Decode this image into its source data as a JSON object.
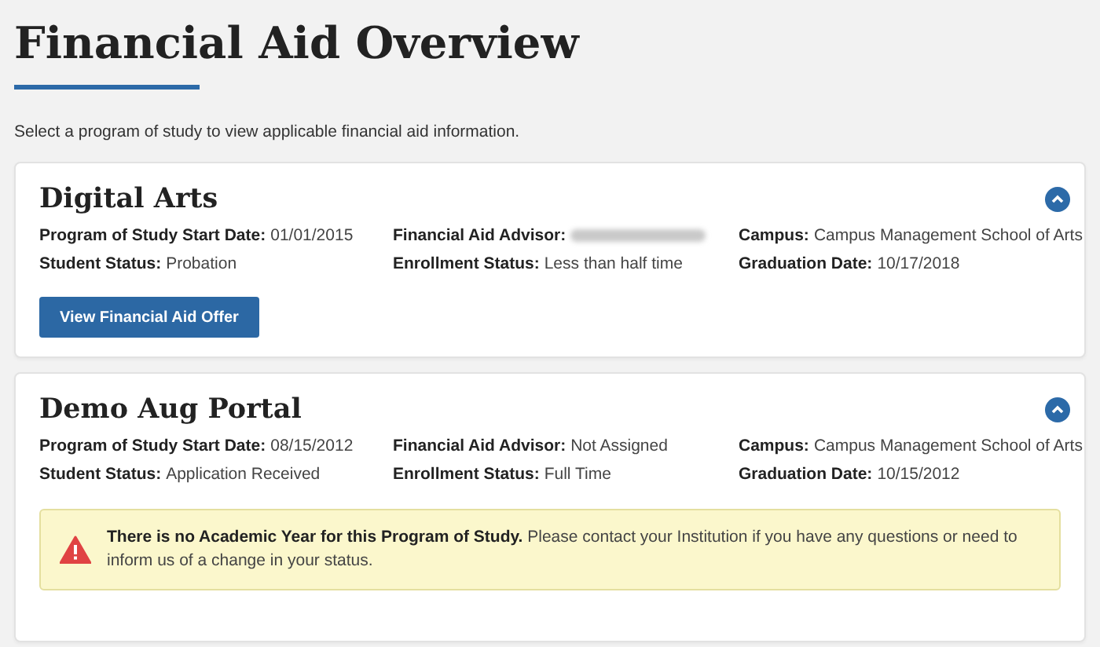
{
  "page": {
    "title": "Financial Aid Overview",
    "subtitle": "Select a program of study to view applicable financial aid information."
  },
  "programs": [
    {
      "name": "Digital Arts",
      "expanded": true,
      "fields": [
        {
          "label": "Program of Study Start Date:",
          "value": "01/01/2015"
        },
        {
          "label": "Financial Aid Advisor:",
          "redacted": true
        },
        {
          "label": "Campus:",
          "value": "Campus Management School of Arts"
        },
        {
          "label": "Student Status:",
          "value": "Probation"
        },
        {
          "label": "Enrollment Status:",
          "value": "Less than half time"
        },
        {
          "label": "Graduation Date:",
          "value": "10/17/2018"
        }
      ],
      "button": "View Financial Aid Offer"
    },
    {
      "name": "Demo Aug Portal",
      "expanded": true,
      "fields": [
        {
          "label": "Program of Study Start Date:",
          "value": "08/15/2012"
        },
        {
          "label": "Financial Aid Advisor:",
          "value": "Not Assigned"
        },
        {
          "label": "Campus:",
          "value": "Campus Management School of Arts"
        },
        {
          "label": "Student Status:",
          "value": "Application Received"
        },
        {
          "label": "Enrollment Status:",
          "value": "Full Time"
        },
        {
          "label": "Graduation Date:",
          "value": "10/15/2012"
        }
      ],
      "notice": {
        "kind": "warning",
        "text": "**There is no Academic Year for this Program of Study.** Please contact your Institution if you have any questions or need to inform us of a change in your status."
      }
    }
  ]
}
